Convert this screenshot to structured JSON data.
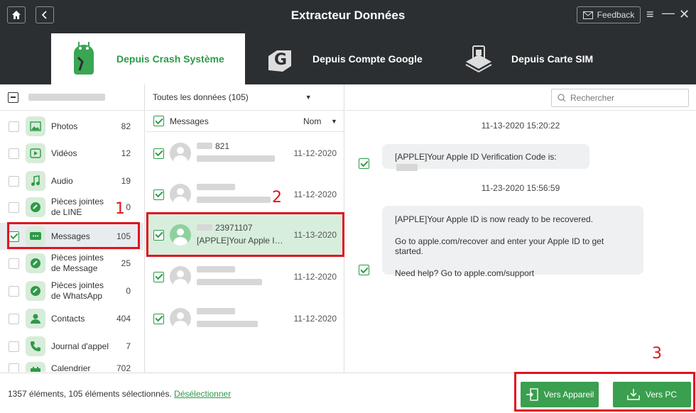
{
  "app": {
    "title": "Extracteur Données",
    "feedback_label": "Feedback",
    "home_icon": "home-icon",
    "back_icon": "back-icon"
  },
  "tabs": [
    {
      "label": "Depuis Crash Système",
      "icon": "android-repair-icon",
      "active": true
    },
    {
      "label": "Depuis Compte Google",
      "icon": "google-account-icon",
      "active": false
    },
    {
      "label": "Depuis Carte SIM",
      "icon": "sim-card-icon",
      "active": false
    }
  ],
  "filter": {
    "label": "Toutes les données (105)"
  },
  "search": {
    "placeholder": "Rechercher"
  },
  "categories": [
    {
      "label": "Photos",
      "count": "82",
      "icon": "photo-icon",
      "checked": false
    },
    {
      "label": "Vidéos",
      "count": "12",
      "icon": "video-icon",
      "checked": false
    },
    {
      "label": "Audio",
      "count": "19",
      "icon": "music-icon",
      "checked": false
    },
    {
      "label": "Pièces jointes de LINE",
      "count": "0",
      "icon": "attachment-icon",
      "checked": false
    },
    {
      "label": "Messages",
      "count": "105",
      "icon": "message-icon",
      "checked": true
    },
    {
      "label": "Pièces jointes de Message",
      "count": "25",
      "icon": "attachment-icon",
      "checked": false
    },
    {
      "label": "Pièces jointes de WhatsApp",
      "count": "0",
      "icon": "attachment-icon",
      "checked": false
    },
    {
      "label": "Contacts",
      "count": "404",
      "icon": "contact-icon",
      "checked": false
    },
    {
      "label": "Journal d'appel",
      "count": "7",
      "icon": "phone-icon",
      "checked": false
    },
    {
      "label": "Calendrier",
      "count": "702",
      "icon": "calendar-icon",
      "checked": false
    }
  ],
  "messages_header": {
    "label": "Messages",
    "sort_label": "Nom"
  },
  "messages": [
    {
      "line1": "821",
      "line2": "",
      "date": "11-12-2020",
      "selected": false
    },
    {
      "line1": "",
      "line2": "",
      "date": "11-12-2020",
      "selected": false
    },
    {
      "line1": "23971107",
      "line2": "[APPLE]Your Apple ID is now ready to be recovered.",
      "date": "11-13-2020",
      "selected": true
    },
    {
      "line1": "",
      "line2": "",
      "date": "11-12-2020",
      "selected": false
    },
    {
      "line1": "",
      "line2": "",
      "date": "11-12-2020",
      "selected": false
    }
  ],
  "conversation": [
    {
      "timestamp": "11-13-2020 15:20:22",
      "text": "[APPLE]Your Apple ID Verification Code is:"
    },
    {
      "timestamp": "11-23-2020 15:56:59",
      "lines": [
        "[APPLE]Your Apple ID is now ready to be recovered.",
        "Go to apple.com/recover and enter your Apple ID to get started.",
        "Need help? Go to apple.com/support"
      ]
    }
  ],
  "status": {
    "text": "1357 éléments, 105 éléments sélectionnés.",
    "deselect_label": "Désélectionner"
  },
  "buttons": {
    "to_device": "Vers Appareil",
    "to_pc": "Vers PC"
  },
  "annotations": [
    "1",
    "2",
    "3"
  ],
  "colors": {
    "accent": "#2e9a48",
    "titlebar": "#2b2f32",
    "annotation": "#e0141e"
  }
}
